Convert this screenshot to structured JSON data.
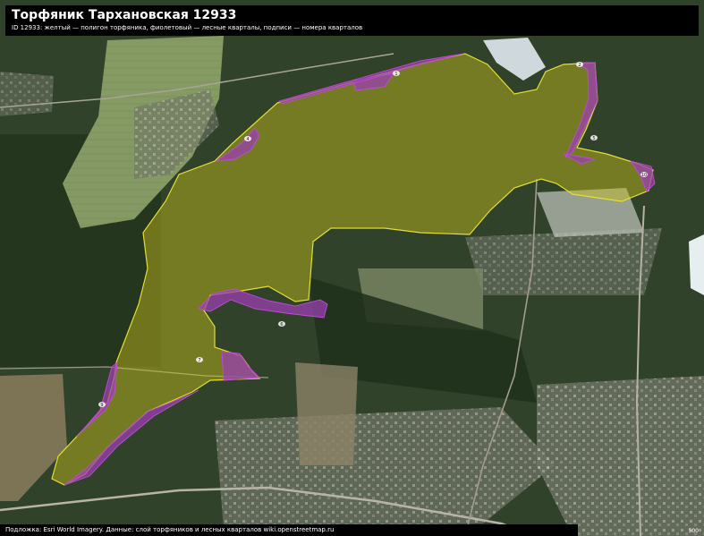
{
  "header": {
    "title": "Торфяник Тархановская 12933",
    "subtitle": "ID 12933: желтый — полигон торфяника, фиолетовый — лесные кварталы, подписи — номера кварталов"
  },
  "footer": {
    "attribution": "Подложка: Esri World Imagery. Данные: слой торфяников и лесных кварталов wiki.openstreetmap.ru",
    "scale": "500"
  },
  "colors": {
    "peat_fill": "#c9c21a",
    "peat_stroke": "#e4df32",
    "forest_fill": "#9b3fb0",
    "forest_stroke": "#c04ad8",
    "water": "#cfd8dc"
  },
  "quarter_labels": [
    "1",
    "2",
    "4",
    "5",
    "6",
    "7",
    "9",
    "10"
  ]
}
